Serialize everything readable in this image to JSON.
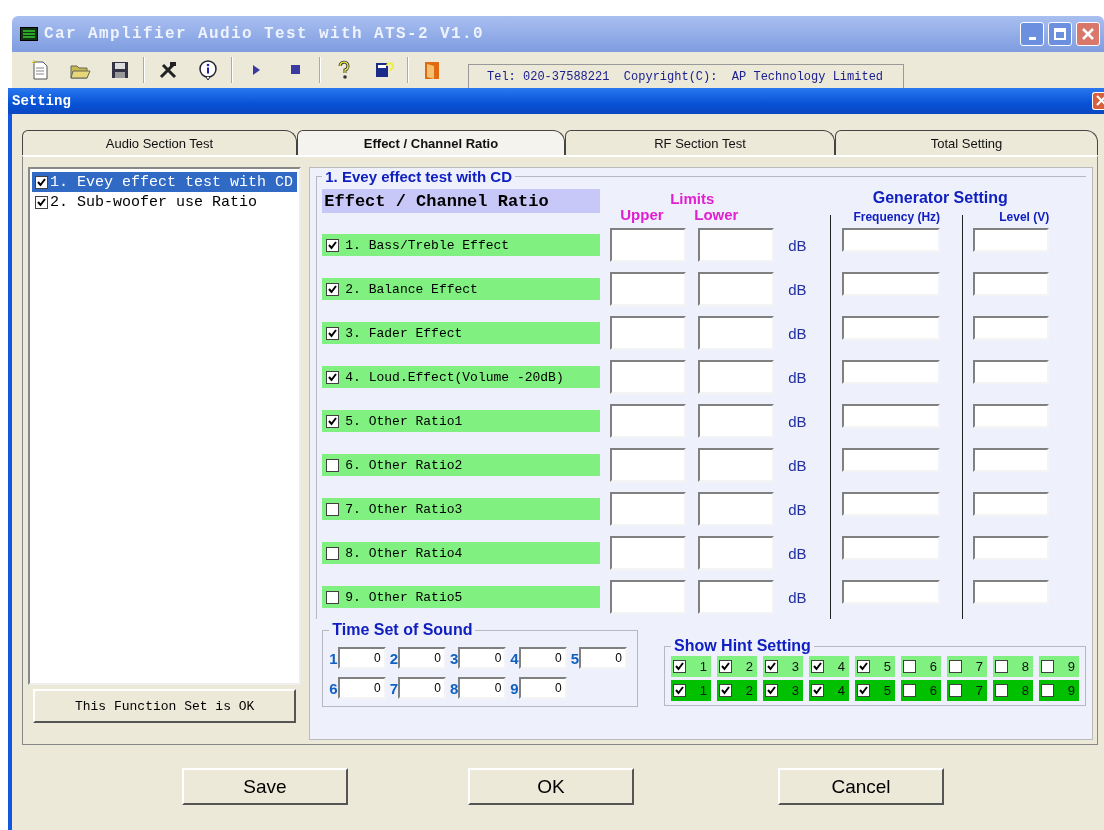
{
  "app_window": {
    "title": "Car Amplifier Audio Test with ATS-2 V1.0",
    "info": "Tel: 020-37588221  Copyright(C):  AP Technology Limited"
  },
  "dialog": {
    "title": "Setting",
    "tabs": [
      {
        "label": "Audio Section Test",
        "selected": false
      },
      {
        "label": "Effect / Channel Ratio",
        "selected": true
      },
      {
        "label": "RF Section Test",
        "selected": false
      },
      {
        "label": "Total Setting",
        "selected": false
      }
    ],
    "function_list": [
      {
        "label": "1. Evey effect test with CD",
        "checked": true,
        "selected": true
      },
      {
        "label": "2. Sub-woofer use Ratio",
        "checked": true,
        "selected": false
      }
    ],
    "function_button": "This Function Set is OK",
    "group_title": "1. Evey effect test with CD",
    "table_title": "Effect / Channel Ratio",
    "limits_header": "Limits",
    "upper_header": "Upper",
    "lower_header": "Lower",
    "generator_header": "Generator Setting",
    "frequency_header": "Frequency (Hz)",
    "level_header": "Level (V)",
    "effects": [
      {
        "label": "1. Bass/Treble Effect",
        "checked": true,
        "unit": "dB"
      },
      {
        "label": "2. Balance Effect",
        "checked": true,
        "unit": "dB"
      },
      {
        "label": "3. Fader Effect",
        "checked": true,
        "unit": "dB"
      },
      {
        "label": "4. Loud.Effect(Volume -20dB)",
        "checked": true,
        "unit": "dB"
      },
      {
        "label": "5. Other Ratio1",
        "checked": true,
        "unit": "dB"
      },
      {
        "label": "6. Other Ratio2",
        "checked": false,
        "unit": "dB"
      },
      {
        "label": "7. Other Ratio3",
        "checked": false,
        "unit": "dB"
      },
      {
        "label": "8. Other Ratio4",
        "checked": false,
        "unit": "dB"
      },
      {
        "label": "9. Other Ratio5",
        "checked": false,
        "unit": "dB"
      }
    ],
    "time_set": {
      "title": "Time Set of Sound",
      "items": [
        {
          "label": "1",
          "value": "0"
        },
        {
          "label": "2",
          "value": "0"
        },
        {
          "label": "3",
          "value": "0"
        },
        {
          "label": "4",
          "value": "0"
        },
        {
          "label": "5",
          "value": "0"
        },
        {
          "label": "6",
          "value": "0"
        },
        {
          "label": "7",
          "value": "0"
        },
        {
          "label": "8",
          "value": "0"
        },
        {
          "label": "9",
          "value": "0"
        }
      ]
    },
    "hint_setting": {
      "title": "Show Hint Setting",
      "rows": [
        {
          "kind": "light",
          "items": [
            {
              "label": "1",
              "checked": true
            },
            {
              "label": "2",
              "checked": true
            },
            {
              "label": "3",
              "checked": true
            },
            {
              "label": "4",
              "checked": true
            },
            {
              "label": "5",
              "checked": true
            },
            {
              "label": "6",
              "checked": false
            },
            {
              "label": "7",
              "checked": false
            },
            {
              "label": "8",
              "checked": false
            },
            {
              "label": "9",
              "checked": false
            }
          ]
        },
        {
          "kind": "dark",
          "items": [
            {
              "label": "1",
              "checked": true
            },
            {
              "label": "2",
              "checked": true
            },
            {
              "label": "3",
              "checked": true
            },
            {
              "label": "4",
              "checked": true
            },
            {
              "label": "5",
              "checked": true
            },
            {
              "label": "6",
              "checked": false
            },
            {
              "label": "7",
              "checked": false
            },
            {
              "label": "8",
              "checked": false
            },
            {
              "label": "9",
              "checked": false
            }
          ]
        }
      ]
    },
    "buttons": [
      "Save",
      "OK",
      "Cancel"
    ]
  }
}
